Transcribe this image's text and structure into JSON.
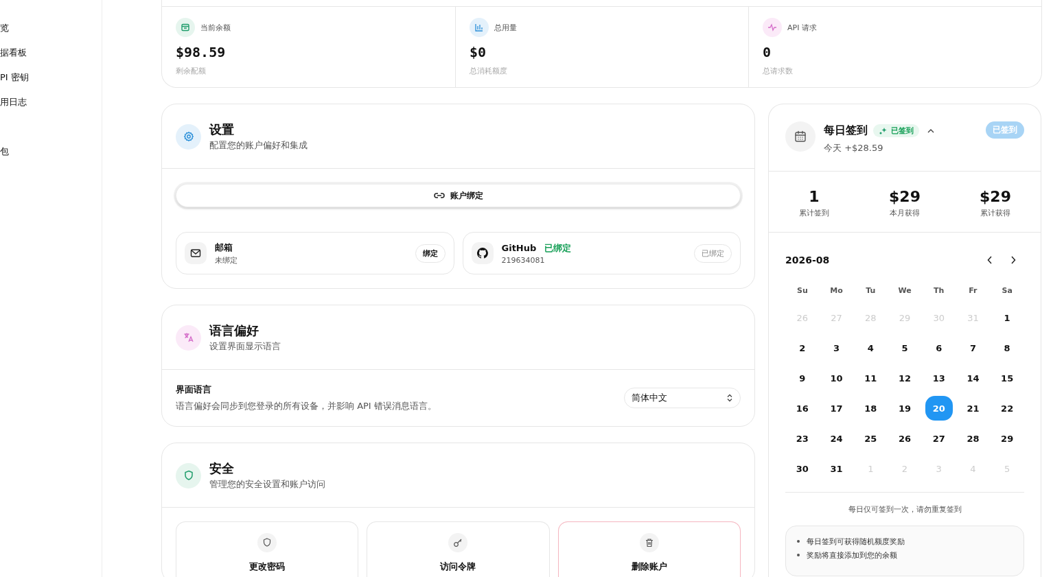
{
  "sidebar": {
    "sections": [
      {
        "items": [
          {
            "label": "览"
          },
          {
            "label": "据看板"
          },
          {
            "label": "PI 密钥"
          },
          {
            "label": "用日志"
          }
        ]
      },
      {
        "items": [
          {
            "label": "包"
          }
        ]
      }
    ]
  },
  "stats": [
    {
      "kind": "balance",
      "label": "当前余额",
      "value": "$98.59",
      "caption": "剩余配额"
    },
    {
      "kind": "usage",
      "label": "总用量",
      "value": "$0",
      "caption": "总消耗额度"
    },
    {
      "kind": "requests",
      "label": "API 请求",
      "value": "0",
      "caption": "总请求数"
    }
  ],
  "settings": {
    "title": "设置",
    "subtitle": "配置您的账户偏好和集成",
    "tab": "账户绑定",
    "bindings": [
      {
        "kind": "email",
        "name": "邮箱",
        "detail": "未绑定",
        "bound": false,
        "action": "绑定"
      },
      {
        "kind": "github",
        "name": "GitHub",
        "detail": "219634081",
        "bound": true,
        "status": "已绑定",
        "action": "已绑定"
      }
    ]
  },
  "language": {
    "title": "语言偏好",
    "subtitle": "设置界面显示语言",
    "field_label": "界面语言",
    "description": "语言偏好会同步到您登录的所有设备，并影响 API 错误消息语言。",
    "value": "简体中文"
  },
  "security": {
    "title": "安全",
    "subtitle": "管理您的安全设置和账户访问",
    "actions": [
      {
        "kind": "password",
        "label": "更改密码",
        "danger": false
      },
      {
        "kind": "token",
        "label": "访问令牌",
        "danger": false
      },
      {
        "kind": "delete",
        "label": "删除账户",
        "danger": true
      }
    ]
  },
  "checkin": {
    "title": "每日签到",
    "badge": "已签到",
    "today": "今天 +$28.59",
    "button": "已签到",
    "checked_in": true,
    "stats": [
      {
        "value": "1",
        "label": "累计签到"
      },
      {
        "value": "$29",
        "label": "本月获得"
      },
      {
        "value": "$29",
        "label": "累计获得"
      }
    ],
    "month": "2026-08",
    "weekdays": [
      "Su",
      "Mo",
      "Tu",
      "We",
      "Th",
      "Fr",
      "Sa"
    ],
    "weeks": [
      [
        {
          "day": "26",
          "outside": true,
          "selected": false
        },
        {
          "day": "27",
          "outside": true,
          "selected": false
        },
        {
          "day": "28",
          "outside": true,
          "selected": false
        },
        {
          "day": "29",
          "outside": true,
          "selected": false
        },
        {
          "day": "30",
          "outside": true,
          "selected": false
        },
        {
          "day": "31",
          "outside": true,
          "selected": false
        },
        {
          "day": "1",
          "outside": false,
          "selected": false
        }
      ],
      [
        {
          "day": "2",
          "outside": false,
          "selected": false
        },
        {
          "day": "3",
          "outside": false,
          "selected": false
        },
        {
          "day": "4",
          "outside": false,
          "selected": false
        },
        {
          "day": "5",
          "outside": false,
          "selected": false
        },
        {
          "day": "6",
          "outside": false,
          "selected": false
        },
        {
          "day": "7",
          "outside": false,
          "selected": false
        },
        {
          "day": "8",
          "outside": false,
          "selected": false
        }
      ],
      [
        {
          "day": "9",
          "outside": false,
          "selected": false
        },
        {
          "day": "10",
          "outside": false,
          "selected": false
        },
        {
          "day": "11",
          "outside": false,
          "selected": false
        },
        {
          "day": "12",
          "outside": false,
          "selected": false
        },
        {
          "day": "13",
          "outside": false,
          "selected": false
        },
        {
          "day": "14",
          "outside": false,
          "selected": false
        },
        {
          "day": "15",
          "outside": false,
          "selected": false
        }
      ],
      [
        {
          "day": "16",
          "outside": false,
          "selected": false
        },
        {
          "day": "17",
          "outside": false,
          "selected": false
        },
        {
          "day": "18",
          "outside": false,
          "selected": false
        },
        {
          "day": "19",
          "outside": false,
          "selected": false
        },
        {
          "day": "20",
          "outside": false,
          "selected": true
        },
        {
          "day": "21",
          "outside": false,
          "selected": false
        },
        {
          "day": "22",
          "outside": false,
          "selected": false
        }
      ],
      [
        {
          "day": "23",
          "outside": false,
          "selected": false
        },
        {
          "day": "24",
          "outside": false,
          "selected": false
        },
        {
          "day": "25",
          "outside": false,
          "selected": false
        },
        {
          "day": "26",
          "outside": false,
          "selected": false
        },
        {
          "day": "27",
          "outside": false,
          "selected": false
        },
        {
          "day": "28",
          "outside": false,
          "selected": false
        },
        {
          "day": "29",
          "outside": false,
          "selected": false
        }
      ],
      [
        {
          "day": "30",
          "outside": false,
          "selected": false
        },
        {
          "day": "31",
          "outside": false,
          "selected": false
        },
        {
          "day": "1",
          "outside": true,
          "selected": false
        },
        {
          "day": "2",
          "outside": true,
          "selected": false
        },
        {
          "day": "3",
          "outside": true,
          "selected": false
        },
        {
          "day": "4",
          "outside": true,
          "selected": false
        },
        {
          "day": "5",
          "outside": true,
          "selected": false
        }
      ]
    ],
    "note": "每日仅可签到一次，请勿重复签到",
    "tips": [
      "每日签到可获得随机额度奖励",
      "奖励将直接添加到您的余额"
    ]
  }
}
